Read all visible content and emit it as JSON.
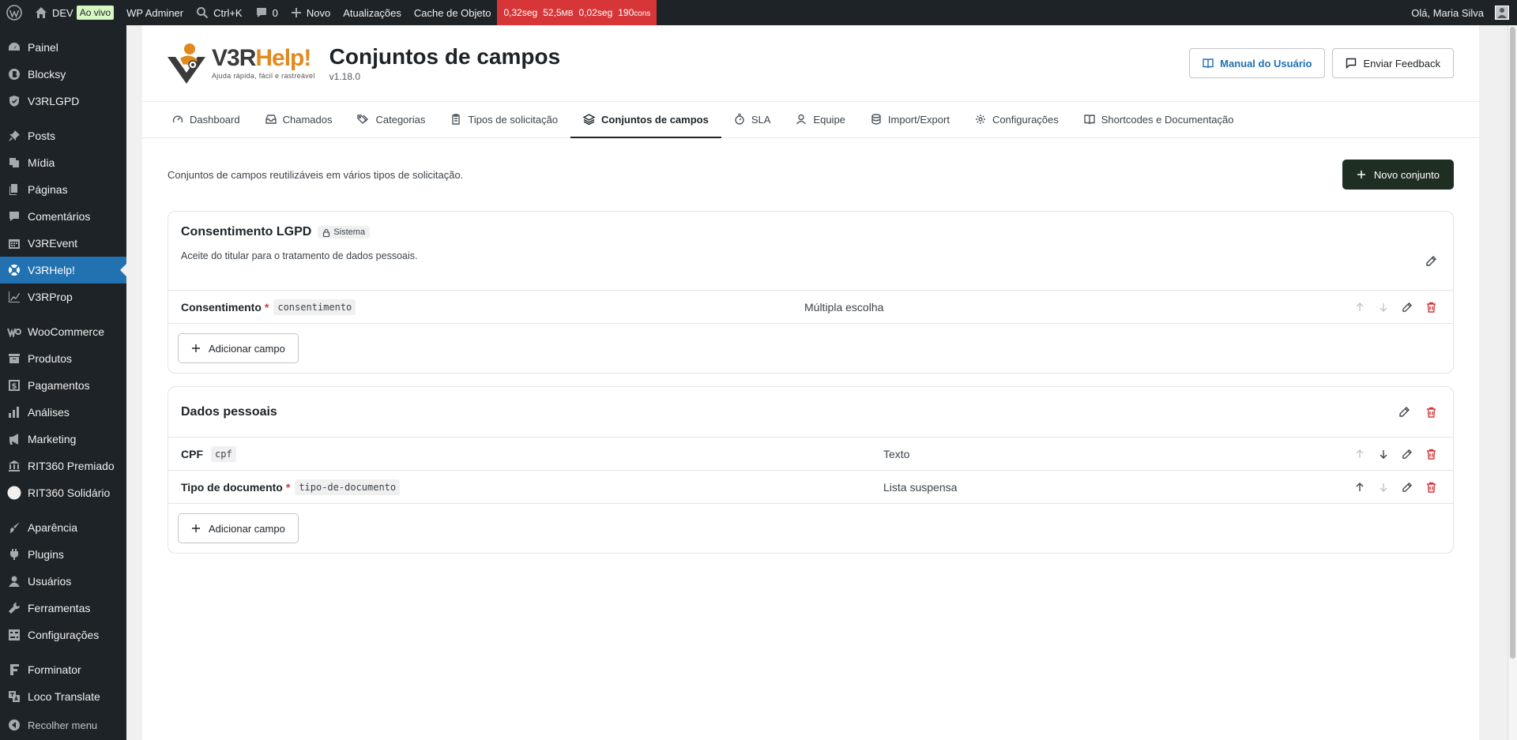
{
  "adminbar": {
    "site": "DEV",
    "live": "Ao vivo",
    "wp_adminer": "WP Adminer",
    "search_shortcut": "Ctrl+K",
    "comments_count": "0",
    "new": "Novo",
    "updates": "Atualizações",
    "cache": "Cache de Objeto",
    "qm_time": "0,32seg",
    "qm_mem_value": "52,5",
    "qm_mem_unit": "MB",
    "qm_db": "0,02seg",
    "qm_queries_value": "190",
    "qm_queries_unit": "cons",
    "greeting": "Olá, Maria Silva"
  },
  "sidebar": {
    "items": [
      {
        "label": "Painel",
        "icon": "dashboard-icon"
      },
      {
        "label": "Blocksy",
        "icon": "blocksy-icon"
      },
      {
        "label": "V3RLGPD",
        "icon": "shield-icon"
      },
      {
        "label": "Posts",
        "icon": "pin-icon"
      },
      {
        "label": "Mídia",
        "icon": "media-icon"
      },
      {
        "label": "Páginas",
        "icon": "pages-icon"
      },
      {
        "label": "Comentários",
        "icon": "comment-icon"
      },
      {
        "label": "V3REvent",
        "icon": "calendar-icon"
      },
      {
        "label": "V3RHelp!",
        "icon": "lifebuoy-icon"
      },
      {
        "label": "V3RProp",
        "icon": "chart-line-icon"
      },
      {
        "label": "WooCommerce",
        "icon": "woo-icon"
      },
      {
        "label": "Produtos",
        "icon": "archive-icon"
      },
      {
        "label": "Pagamentos",
        "icon": "dollar-icon"
      },
      {
        "label": "Análises",
        "icon": "bar-chart-icon"
      },
      {
        "label": "Marketing",
        "icon": "megaphone-icon"
      },
      {
        "label": "RIT360 Premiado",
        "icon": "bank-icon"
      },
      {
        "label": "RIT360 Solidário",
        "icon": "circle-icon"
      },
      {
        "label": "Aparência",
        "icon": "brush-icon"
      },
      {
        "label": "Plugins",
        "icon": "plugin-icon"
      },
      {
        "label": "Usuários",
        "icon": "user-icon"
      },
      {
        "label": "Ferramentas",
        "icon": "wrench-icon"
      },
      {
        "label": "Configurações",
        "icon": "settings-icon"
      },
      {
        "label": "Forminator",
        "icon": "forminator-icon"
      },
      {
        "label": "Loco Translate",
        "icon": "translate-icon"
      }
    ],
    "collapse": "Recolher menu"
  },
  "header": {
    "logo_brand_v": "V3R",
    "logo_brand_h": "Help!",
    "logo_tagline": "Ajuda rápida, fácil e rastreável",
    "title": "Conjuntos de campos",
    "version": "v1.18.0",
    "manual_button": "Manual do Usuário",
    "feedback_button": "Enviar Feedback"
  },
  "tabs": [
    {
      "label": "Dashboard",
      "icon": "gauge-icon"
    },
    {
      "label": "Chamados",
      "icon": "inbox-icon"
    },
    {
      "label": "Categorias",
      "icon": "tags-icon"
    },
    {
      "label": "Tipos de solicitação",
      "icon": "clipboard-icon"
    },
    {
      "label": "Conjuntos de campos",
      "icon": "layers-icon"
    },
    {
      "label": "SLA",
      "icon": "timer-icon"
    },
    {
      "label": "Equipe",
      "icon": "user-icon"
    },
    {
      "label": "Import/Export",
      "icon": "database-icon"
    },
    {
      "label": "Configurações",
      "icon": "gear-icon"
    },
    {
      "label": "Shortcodes e Documentação",
      "icon": "book-icon"
    }
  ],
  "main": {
    "intro": "Conjuntos de campos reutilizáveis em vários tipos de solicitação.",
    "new_set_button": "Novo conjunto",
    "add_field_label": "Adicionar campo",
    "sets": [
      {
        "title": "Consentimento LGPD",
        "badge": "Sistema",
        "description": "Aceite do titular para o tratamento de dados pessoais.",
        "fields": [
          {
            "label": "Consentimento",
            "required": "*",
            "key": "consentimento",
            "type": "Múltipla escolha"
          }
        ]
      },
      {
        "title": "Dados pessoais",
        "fields": [
          {
            "label": "CPF",
            "required": "",
            "key": "cpf",
            "type": "Texto"
          },
          {
            "label": "Tipo de documento",
            "required": "*",
            "key": "tipo-de-documento",
            "type": "Lista suspensa"
          }
        ]
      }
    ]
  }
}
